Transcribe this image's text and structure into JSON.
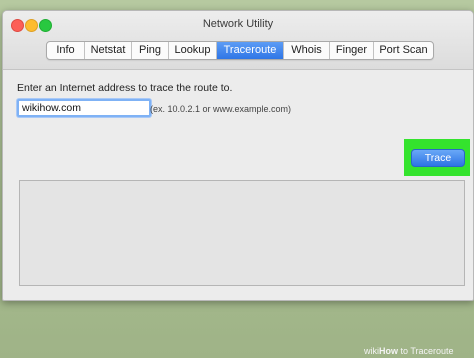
{
  "window": {
    "title": "Network Utility"
  },
  "tabs": [
    {
      "label": "Info",
      "active": false
    },
    {
      "label": "Netstat",
      "active": false
    },
    {
      "label": "Ping",
      "active": false
    },
    {
      "label": "Lookup",
      "active": false
    },
    {
      "label": "Traceroute",
      "active": true
    },
    {
      "label": "Whois",
      "active": false
    },
    {
      "label": "Finger",
      "active": false
    },
    {
      "label": "Port Scan",
      "active": false
    }
  ],
  "traceroute": {
    "prompt": "Enter an Internet address to trace the route to.",
    "address_value": "wikihow.com",
    "hint": "(ex. 10.0.2.1 or www.example.com)",
    "trace_button": "Trace"
  },
  "watermark": {
    "brand": "wiki",
    "how": "How",
    "text": " to Traceroute"
  },
  "colors": {
    "accent": "#2f76e6",
    "highlight": "#34e32d"
  }
}
